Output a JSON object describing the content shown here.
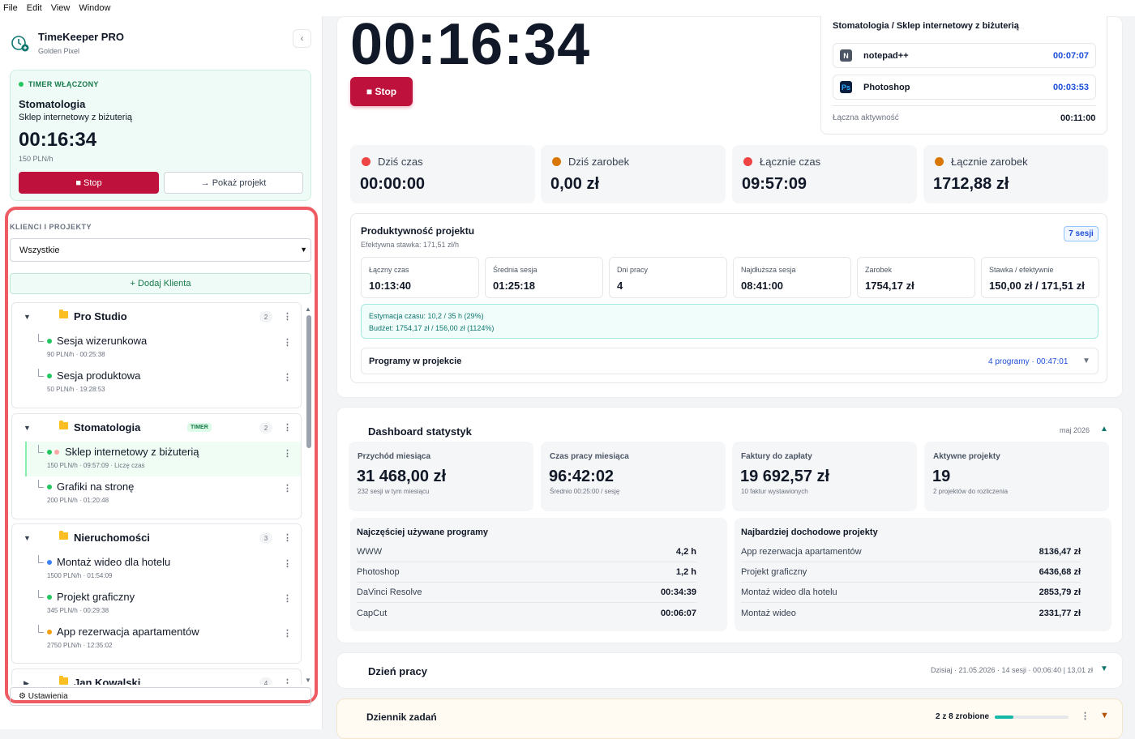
{
  "menu": [
    "File",
    "Edit",
    "View",
    "Window"
  ],
  "app": {
    "title": "TimeKeeper PRO",
    "subtitle": "Golden Pixel",
    "collapse_icon": "chevron-left-icon"
  },
  "timer": {
    "status": "TIMER WŁĄCZONY",
    "client": "Stomatologia",
    "project": "Sklep internetowy z biżuterią",
    "time": "00:16:34",
    "rate": "150 PLN/h",
    "stop_label": "■ Stop",
    "show_label": "→ Pokaż projekt"
  },
  "clients_panel": {
    "title": "KLIENCI I PROJEKTY",
    "filter_value": "Wszystkie",
    "add_client_label": "+ Dodaj Klienta",
    "clients": [
      {
        "name": "Pro Studio",
        "count": "2",
        "badge": "",
        "projects": [
          {
            "name": "Sesja wizerunkowa",
            "meta": "90 PLN/h · 00:25:38",
            "dot": "#22c55e"
          },
          {
            "name": "Sesja produktowa",
            "meta": "50 PLN/h · 19:28:53",
            "dot": "#22c55e"
          }
        ]
      },
      {
        "name": "Stomatologia",
        "count": "2",
        "badge": "TIMER",
        "projects": [
          {
            "name": "Sklep internetowy z biżuterią",
            "meta": "150 PLN/h · 09:57:09 · Liczę czas",
            "dot": "#22c55e",
            "active": true
          },
          {
            "name": "Grafiki na stronę",
            "meta": "200 PLN/h · 01:20:48",
            "dot": "#22c55e"
          }
        ]
      },
      {
        "name": "Nieruchomości",
        "count": "3",
        "badge": "",
        "projects": [
          {
            "name": "Montaż wideo dla hotelu",
            "meta": "1500 PLN/h · 01:54:09",
            "dot": "#3b82f6"
          },
          {
            "name": "Projekt graficzny",
            "meta": "345 PLN/h · 00:29:38",
            "dot": "#22c55e"
          },
          {
            "name": "App rezerwacja apartamentów",
            "meta": "2750 PLN/h · 12:35:02",
            "dot": "#f59e0b"
          }
        ]
      },
      {
        "name": "Jan Kowalski",
        "count": "4",
        "badge": "",
        "projects": []
      }
    ]
  },
  "settings_label": "⚙ Ustawienia",
  "main_timer": {
    "time": "00:16:34",
    "stop_label": "■ Stop"
  },
  "activity": {
    "title": "Stomatologia / Sklep internetowy z biżuterią",
    "apps": [
      {
        "name": "notepad++",
        "time": "00:07:07",
        "icon": "notepad-plus-plus-icon",
        "icon_letter": "N",
        "icon_bg": "#4b5563"
      },
      {
        "name": "Photoshop",
        "time": "00:03:53",
        "icon": "photoshop-icon",
        "icon_letter": "Ps",
        "icon_bg": "#0b1e3f"
      }
    ],
    "total_label": "Łączna aktywność",
    "total_value": "00:11:00"
  },
  "stats": [
    {
      "label": "Dziś czas",
      "value": "00:00:00",
      "icon": "alarm-clock-icon",
      "color": "#ef4444"
    },
    {
      "label": "Dziś zarobek",
      "value": "0,00 zł",
      "icon": "money-bag-icon",
      "color": "#d97706"
    },
    {
      "label": "Łącznie czas",
      "value": "09:57:09",
      "icon": "alarm-clock-icon",
      "color": "#ef4444"
    },
    {
      "label": "Łącznie zarobek",
      "value": "1712,88 zł",
      "icon": "money-bag-icon",
      "color": "#d97706"
    }
  ],
  "productivity": {
    "title": "Produktywność projektu",
    "subtitle": "Efektywna stawka: 171,51 zł/h",
    "sessions": "7 sesji",
    "metrics": [
      {
        "label": "Łączny czas",
        "value": "10:13:40"
      },
      {
        "label": "Średnia sesja",
        "value": "01:25:18"
      },
      {
        "label": "Dni pracy",
        "value": "4"
      },
      {
        "label": "Najdłuższa sesja",
        "value": "08:41:00"
      },
      {
        "label": "Zarobek",
        "value": "1754,17 zł"
      },
      {
        "label": "Stawka / efektywnie",
        "value": "150,00 zł / 171,51 zł"
      }
    ],
    "estimate": "Estymacja czasu: 10,2 / 35 h (29%)",
    "budget": "Budżet: 1754,17 zł / 156,00 zł (1124%)",
    "programs_label": "Programy w projekcie",
    "programs_summary": "4 programy · 00:47:01"
  },
  "dashboard": {
    "title": "Dashboard statystyk",
    "month": "maj 2026",
    "kpis": [
      {
        "label": "Przychód miesiąca",
        "value": "31 468,00 zł",
        "sub": "232 sesji w tym miesiącu"
      },
      {
        "label": "Czas pracy miesiąca",
        "value": "96:42:02",
        "sub": "Średnio 00:25:00 / sesję"
      },
      {
        "label": "Faktury do zapłaty",
        "value": "19 692,57 zł",
        "sub": "10 faktur wystawionych"
      },
      {
        "label": "Aktywne projekty",
        "value": "19",
        "sub": "2 projektów do rozliczenia"
      }
    ],
    "top_programs": {
      "title": "Najczęściej używane programy",
      "rows": [
        {
          "name": "WWW",
          "value": "4,2 h"
        },
        {
          "name": "Photoshop",
          "value": "1,2 h"
        },
        {
          "name": "DaVinci Resolve",
          "value": "00:34:39"
        },
        {
          "name": "CapCut",
          "value": "00:06:07"
        }
      ]
    },
    "top_projects": {
      "title": "Najbardziej dochodowe projekty",
      "rows": [
        {
          "name": "App rezerwacja apartamentów",
          "value": "8136,47 zł"
        },
        {
          "name": "Projekt graficzny",
          "value": "6436,68 zł"
        },
        {
          "name": "Montaż wideo dla hotelu",
          "value": "2853,79 zł"
        },
        {
          "name": "Montaż wideo",
          "value": "2331,77 zł"
        }
      ]
    }
  },
  "workday": {
    "title": "Dzień pracy",
    "info": "Dzisiaj · 21.05.2026 · 14 sesji · 00:06:40 | 13,01 zł"
  },
  "tasks": {
    "title": "Dziennik zadań",
    "info": "2 z 8 zrobione",
    "progress": 0.25
  }
}
